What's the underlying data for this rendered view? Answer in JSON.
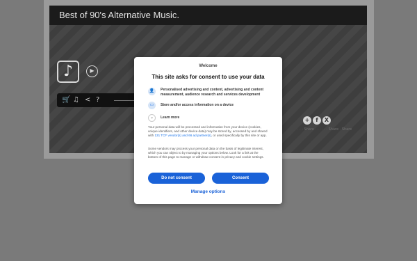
{
  "player": {
    "title": "Best of 90's Alternative Music."
  },
  "controls": {
    "icons": [
      "cart-icon",
      "music-note-icon",
      "share-icon",
      "help-icon"
    ],
    "cart_glyph": "🛒",
    "note_glyph": "♫",
    "share_glyph": "<",
    "help_glyph": "?"
  },
  "share": {
    "plus_glyph": "+",
    "facebook_glyph": "f",
    "x_glyph": "X",
    "caption": "· · · Share · · · · · · Share · Share"
  },
  "consent": {
    "welcome": "Welcome",
    "heading": "This site asks for consent to use your data",
    "purposes": [
      {
        "icon": "person-icon",
        "glyph": "👤",
        "text": "Personalised advertising and content, advertising and content measurement, audience research and services development"
      },
      {
        "icon": "device-icon",
        "glyph": "▭",
        "text": "Store and/or access information on a device"
      }
    ],
    "learn_more": "Learn more",
    "learn_more_glyph": "⌄",
    "paragraph1_before": "Your personal data will be processed and information from your device (cookies, unique identifiers, and other device data) may be stored by, accessed by and shared with ",
    "paragraph1_link": "131 TCF vendor(s) and 66 ad partner(s)",
    "paragraph1_after": ", or used specifically by this site or app.",
    "paragraph2": "Some vendors may process your personal data on the basis of legitimate interest, which you can object to by managing your options below. Look for a link at the bottom of this page to manage or withdraw consent in privacy and cookie settings.",
    "do_not_consent_label": "Do not consent",
    "consent_label": "Consent",
    "manage_options_label": "Manage options"
  },
  "colors": {
    "accent": "#1a62d8",
    "link": "#1a73e8"
  }
}
